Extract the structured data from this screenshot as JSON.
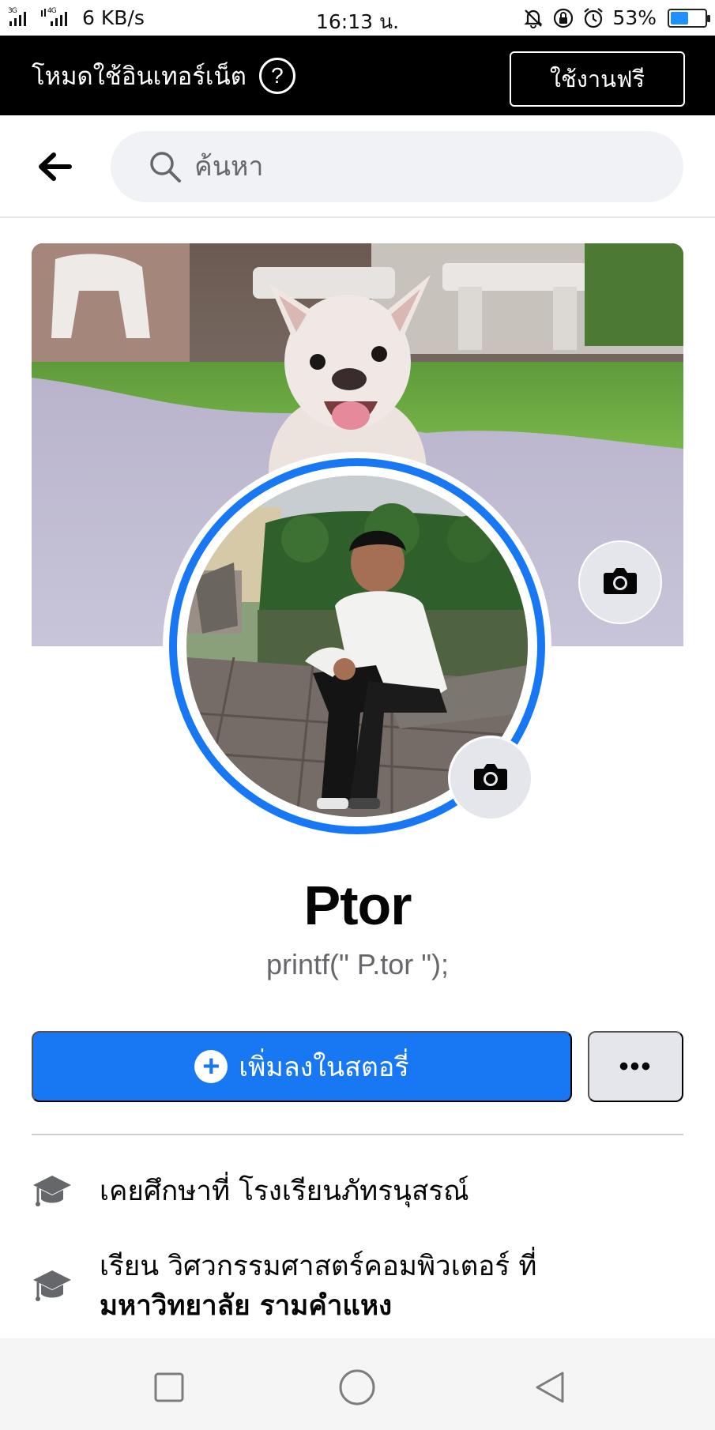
{
  "status_bar": {
    "network": "6 KB/s",
    "time": "16:13 น.",
    "battery": "53%",
    "battery_level": 0.53,
    "icons": [
      "signal-3g-icon",
      "signal-4g-icon",
      "mute-icon",
      "rotation-lock-icon",
      "alarm-icon",
      "battery-icon"
    ]
  },
  "banner": {
    "mode_text": "โหมดใช้อินเทอร์เน็ต",
    "help_symbol": "?",
    "free_button": "ใช้งานฟรี"
  },
  "search": {
    "placeholder": "ค้นหา"
  },
  "profile": {
    "name": "Ptor",
    "bio": "printf(\" P.tor \");"
  },
  "actions": {
    "add_story": "เพิ่มลงในสตอรี่",
    "plus_symbol": "+",
    "more": "•••"
  },
  "info": {
    "studied_at": "เคยศึกษาที่ โรงเรียนภัทรนุสรณ์",
    "studies_line1": "เรียน วิศวกรรมศาสตร์คอมพิวเตอร์ ที่",
    "studies_line2": "มหาวิทยาลัย รามคำแหง"
  },
  "colors": {
    "accent": "#1877f2",
    "banner_bg": "#000000",
    "button_gray": "#e4e6eb",
    "secondary_text": "#65676b"
  }
}
